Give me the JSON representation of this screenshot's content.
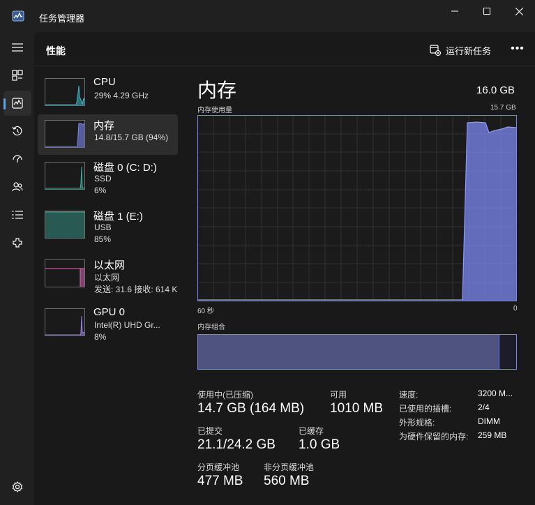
{
  "window": {
    "title": "任务管理器",
    "app_icon": "task-manager-icon",
    "controls": [
      "minimize-icon",
      "maximize-icon",
      "close-icon"
    ]
  },
  "sidebar": {
    "items": [
      {
        "icon": "hamburger-menu-icon",
        "active": false
      },
      {
        "icon": "processes-icon",
        "active": false
      },
      {
        "icon": "performance-icon",
        "active": true
      },
      {
        "icon": "app-history-icon",
        "active": false
      },
      {
        "icon": "startup-apps-icon",
        "active": false
      },
      {
        "icon": "users-icon",
        "active": false
      },
      {
        "icon": "details-icon",
        "active": false
      },
      {
        "icon": "services-icon",
        "active": false
      }
    ],
    "settings_icon": "settings-icon"
  },
  "header": {
    "title": "性能",
    "run_task_label": "运行新任务",
    "more_label": "•••"
  },
  "devices": [
    {
      "name": "CPU",
      "sub1": "29%  4.29 GHz",
      "sub2": "",
      "color": "#3fb6c8",
      "selected": false
    },
    {
      "name": "内存",
      "sub1": "14.8/15.7 GB (94%)",
      "sub2": "",
      "color": "#7b88f0",
      "selected": true
    },
    {
      "name": "磁盘 0 (C: D:)",
      "sub1": "SSD",
      "sub2": "6%",
      "color": "#3aa89a",
      "selected": false
    },
    {
      "name": "磁盘 1 (E:)",
      "sub1": "USB",
      "sub2": "85%",
      "color": "#3aa89a",
      "selected": false
    },
    {
      "name": "以太网",
      "sub1": "以太网",
      "sub2": "发送: 31.6  接收: 614 K",
      "color": "#e06cb5",
      "selected": false
    },
    {
      "name": "GPU 0",
      "sub1": "Intel(R) UHD Gr...",
      "sub2": "8%",
      "color": "#9b7ee0",
      "selected": false
    }
  ],
  "memory": {
    "title": "内存",
    "total": "16.0 GB",
    "usage_label": "内存使用量",
    "usage_max": "15.7 GB",
    "axis_left": "60 秒",
    "axis_right": "0",
    "composition_label": "内存组合",
    "composition_used_fraction": 0.945,
    "graph_color": "#7b88f0",
    "stats": {
      "in_use_label": "使用中(已压缩)",
      "in_use_value": "14.7 GB (164 MB)",
      "available_label": "可用",
      "available_value": "1010 MB",
      "committed_label": "已提交",
      "committed_value": "21.1/24.2 GB",
      "cached_label": "已缓存",
      "cached_value": "1.0 GB",
      "paged_label": "分页缓冲池",
      "paged_value": "477 MB",
      "nonpaged_label": "非分页缓冲池",
      "nonpaged_value": "560 MB"
    },
    "details": [
      {
        "label": "速度:",
        "value": "3200 M..."
      },
      {
        "label": "已使用的插槽:",
        "value": "2/4"
      },
      {
        "label": "外形规格:",
        "value": "DIMM"
      },
      {
        "label": "为硬件保留的内存:",
        "value": "259 MB"
      }
    ]
  }
}
